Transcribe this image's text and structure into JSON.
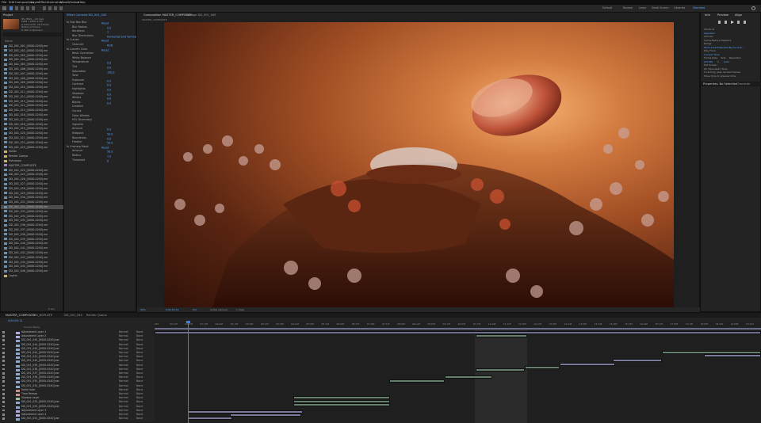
{
  "menu": [
    "File",
    "Edit",
    "Composition",
    "Layer",
    "Effect",
    "Animation",
    "View",
    "Window",
    "Help"
  ],
  "workspace_tabs": [
    "Default",
    "Review",
    "Learn",
    "Small Screen",
    "Libraries",
    "Standard"
  ],
  "project_panel": {
    "tab": "Project",
    "thumb_info": [
      "MS_M001_...03.mp4",
      "1920 x 1080 (1.00)",
      "Δ 0;00;10;00, 23.976 fps",
      "Millions of Colors",
      "H.264 Compressed"
    ],
    "search_placeholder": "ρ•",
    "header_name": "Name",
    "items": [
      "DD_001_001_[0000-0240].exr",
      "DD_001_002_[0000-0240].exr",
      "DD_001_003_[0000-0240].exr",
      "DD_001_004_[0000-0240].exr",
      "DD_001_005_[0000-0240].exr",
      "DD_001_006_[0000-0240].exr",
      "DD_001_007_[0000-0240].exr",
      "DD_001_008_[0000-0240].exr",
      "DD_001_009_[0000-0240].exr",
      "DD_001_010_[0000-0240].exr",
      "DD_001_011_[0000-0240].exr",
      "DD_001_012_[0000-0240].exr",
      "DD_001_013_[0000-0240].exr",
      "DD_001_014_[0000-0240].exr",
      "DD_001_015_[0000-0240].exr",
      "DD_001_016_[0000-0240].exr",
      "DD_001_017_[0000-0240].exr",
      "DD_001_018_[0000-0240].exr",
      "DD_001_019_[0000-0240].exr",
      "DD_001_020_[0000-0240].exr",
      "DD_001_021_[0000-0240].exr",
      "DD_001_022_[0000-0240].exr",
      "DD_001_023_[0000-0240].exr",
      "Solids",
      "Render Comps",
      "Precomps",
      "MASTER_COMPOSITE",
      "DD_001_024_[0000-0240].exr",
      "DD_001_025_[0000-0240].exr",
      "DD_001_026_[0000-0240].exr",
      "DD_001_027_[0000-0240].exr",
      "DD_001_028_[0000-0240].exr",
      "DD_001_029_[0000-0240].exr",
      "DD_001_030_[0000-0240].exr",
      "DD_001_031_[0000-0240].exr",
      "DD_001_032_[0000-0240].exr",
      "DD_001_033_[0000-0240].exr",
      "DD_001_034_[0000-0240].exr",
      "DD_001_035_[0000-0240].exr",
      "DD_001_036_[0000-0240].exr",
      "DD_001_037_[0000-0240].exr",
      "DD_001_038_[0000-0240].exr",
      "DD_001_039_[0000-0240].exr",
      "DD_001_040_[0000-0240].exr",
      "DD_001_041_[0000-0240].exr",
      "DD_001_042_[0000-0240].exr",
      "DD_001_043_[0000-0240].exr",
      "DD_001_044_[0000-0240].exr",
      "DD_001_045_[0000-0240].exr",
      "DD_001_046_[0000-0240].exr",
      "Layers"
    ],
    "selected_index": 35,
    "footer": "8 bpc"
  },
  "effects_panel": {
    "tab": "Effect Controls DD_001_045",
    "rows": [
      {
        "label": "fx  Fast Box Blur",
        "value": "Reset"
      },
      {
        "label": "Blur Radius",
        "value": "0.0"
      },
      {
        "label": "Iterations",
        "value": "1"
      },
      {
        "label": "Blur Dimensions",
        "value": "Horizontal and Vertical"
      },
      {
        "label": "fx  Curves",
        "value": "Reset"
      },
      {
        "label": "Channel:",
        "value": "RGB"
      },
      {
        "label": "fx  Lumetri Color",
        "value": "Reset"
      },
      {
        "label": "Basic Correction",
        "value": ""
      },
      {
        "label": "White Balance",
        "value": ""
      },
      {
        "label": "Temperature",
        "value": "0.0"
      },
      {
        "label": "Tint",
        "value": "0.0"
      },
      {
        "label": "Saturation",
        "value": "100.0"
      },
      {
        "label": "Tone",
        "value": ""
      },
      {
        "label": "Exposure",
        "value": "0.0"
      },
      {
        "label": "Contrast",
        "value": "0.0"
      },
      {
        "label": "Highlights",
        "value": "0.0"
      },
      {
        "label": "Shadows",
        "value": "0.0"
      },
      {
        "label": "Whites",
        "value": "0.0"
      },
      {
        "label": "Blacks",
        "value": "0.0"
      },
      {
        "label": "Creative",
        "value": ""
      },
      {
        "label": "Curves",
        "value": ""
      },
      {
        "label": "Color Wheels",
        "value": ""
      },
      {
        "label": "HSL Secondary",
        "value": ""
      },
      {
        "label": "Vignette",
        "value": ""
      },
      {
        "label": "Amount",
        "value": "0.0"
      },
      {
        "label": "Midpoint",
        "value": "50.0"
      },
      {
        "label": "Roundness",
        "value": "0.0"
      },
      {
        "label": "Feather",
        "value": "50.0"
      },
      {
        "label": "fx  Unsharp Mask",
        "value": "Reset"
      },
      {
        "label": "Amount",
        "value": "50.0"
      },
      {
        "label": "Radius",
        "value": "1.0"
      },
      {
        "label": "Threshold",
        "value": "0"
      }
    ]
  },
  "viewer": {
    "tab": "Composition MASTER_COMPOSITE",
    "tab2": "Footage DD_001_045",
    "sub_tab": "MASTER_COMPOSITE",
    "zoom": "50%",
    "timecode": "0;00;03;12",
    "quality": "Full",
    "camera": "Active Camera",
    "views": "1 View"
  },
  "right_panel": {
    "tabs": [
      "Info",
      "Preview",
      "Align"
    ],
    "section_label": "Shortcut",
    "shortcut_value": "Spacebar",
    "include": "Include:",
    "cache": "Cache Before Playback",
    "range": "Range",
    "range_value": "Work Area Extended By Current...",
    "play_from": "Play From",
    "play_from_value": "Current Time",
    "frame_rate": "Frame Rate",
    "skip": "Skip",
    "resolution": "Resolution",
    "frame_rate_value": "(23.98)",
    "skip_value": "0",
    "resolution_value": "Auto",
    "full_screen": "Full Screen",
    "on_stop": "On (Spacebar) Stop:",
    "if_caching": "If caching, play cached frames",
    "move_time": "Move time to preview time",
    "tab_bottom": "Properties: No Selection",
    "tab_bottom2": "Character"
  },
  "timeline": {
    "tabs": [
      "MASTER_COMPOSITE",
      "VFX_BGPLATE",
      "DD_001_045",
      "Render Queue"
    ],
    "current_time": "0;00;03;12",
    "ruler": [
      "00f",
      "00:12f",
      "01:00f",
      "01:12f",
      "02:00f",
      "02:12f",
      "03:00f",
      "03:12f",
      "04:00f",
      "04:12f",
      "05:00f",
      "05:12f",
      "06:00f",
      "06:12f",
      "07:00f",
      "07:12f",
      "08:00f",
      "08:12f",
      "09:00f",
      "09:12f",
      "10:00f",
      "10:12f",
      "11:00f",
      "11:12f",
      "12:00f",
      "12:12f",
      "13:00f",
      "13:12f",
      "14:00f",
      "14:12f",
      "15:00f",
      "15:12f",
      "16:00f",
      "16:12f",
      "17:00f",
      "17:12f",
      "18:00f",
      "18:12f",
      "19:00f",
      "19:12f"
    ],
    "header": "Source Name",
    "layers": [
      {
        "name": "Adjustment Layer 1",
        "color": "#b0b0e0"
      },
      {
        "name": "Adjustment Layer 2",
        "color": "#b0b0e0"
      },
      {
        "name": "DD_001_045_[0000-0240].exr",
        "color": "#8fa8c8"
      },
      {
        "name": "DD_001_044_[0000-0240].exr",
        "color": "#8fa8c8"
      },
      {
        "name": "DD_001_043_[0000-0240].exr",
        "color": "#8fa8c8"
      },
      {
        "name": "DD_001_042_[0000-0240].exr",
        "color": "#8fa8c8"
      },
      {
        "name": "DD_001_041_[0000-0240].exr",
        "color": "#8fa8c8"
      },
      {
        "name": "DD_001_040_[0000-0240].exr",
        "color": "#8fa8c8"
      },
      {
        "name": "DD_001_039_[0000-0240].exr",
        "color": "#8fa8c8"
      },
      {
        "name": "DD_001_038_[0000-0240].exr",
        "color": "#8fa8c8"
      },
      {
        "name": "DD_001_037_[0000-0240].exr",
        "color": "#8fa8c8"
      },
      {
        "name": "DD_001_036_[0000-0240].exr",
        "color": "#8fa8c8"
      },
      {
        "name": "DD_001_035_[0000-0240].exr",
        "color": "#8fa8c8"
      },
      {
        "name": "DD_001_034_[0000-0240].exr",
        "color": "#8fa8c8"
      },
      {
        "name": "Solid Color",
        "color": "#c89090"
      },
      {
        "name": "Time Remap",
        "color": "#c89090"
      },
      {
        "name": "Shadow Layer",
        "color": "#a0c0a0"
      },
      {
        "name": "DD_001_033_[0000-0240].exr",
        "color": "#8fa8c8"
      },
      {
        "name": "DD_001_032_[0000-0240].exr",
        "color": "#8fa8c8"
      },
      {
        "name": "Adjustment Layer 3",
        "color": "#b0b0e0"
      },
      {
        "name": "Adjustment Layer 4",
        "color": "#b0b0e0"
      },
      {
        "name": "DD_001_031_[0000-0240].exr",
        "color": "#8fa8c8"
      }
    ],
    "mode": "Normal",
    "parent": "None"
  }
}
